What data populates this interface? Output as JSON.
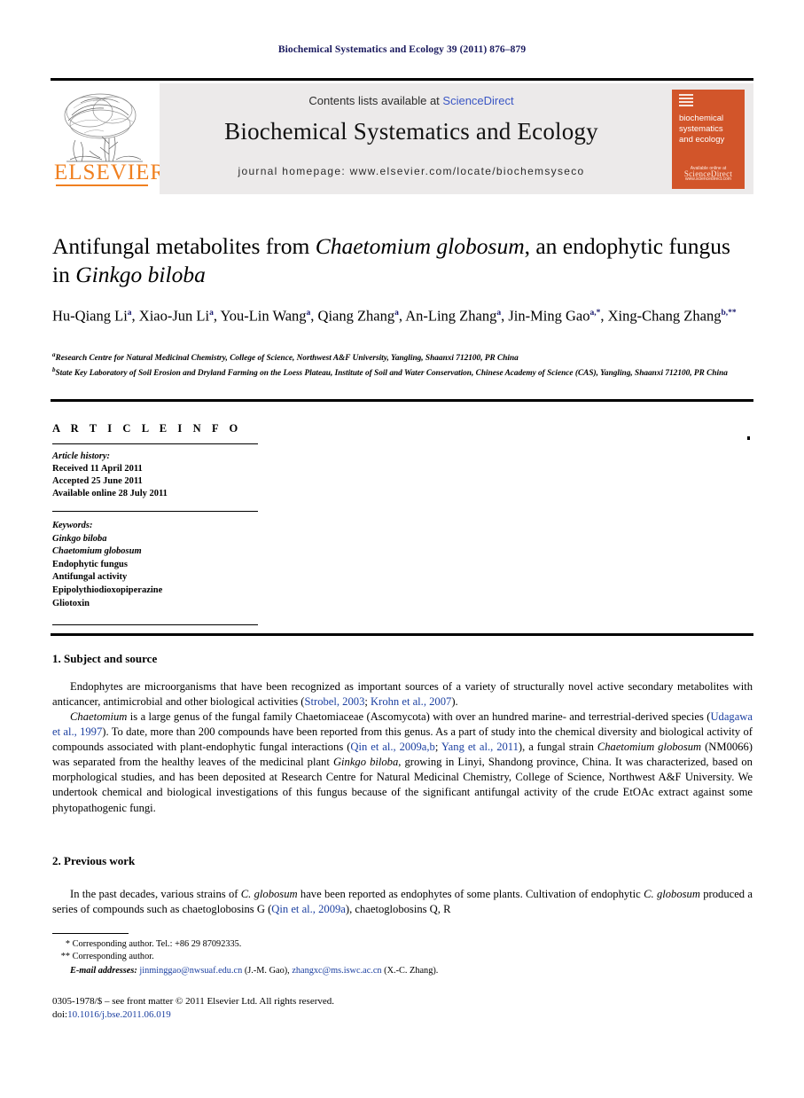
{
  "running_head": "Biochemical Systematics and Ecology 39 (2011) 876–879",
  "masthead": {
    "contents_prefix": "Contents lists available at ",
    "sciencedirect": "ScienceDirect",
    "journal_title": "Biochemical Systematics and Ecology",
    "homepage": "journal homepage: www.elsevier.com/locate/biochemsyseco",
    "publisher_logo_text": "ELSEVIER",
    "cover": {
      "line1": "biochemical",
      "line2": "systematics",
      "line3": "and ecology",
      "foot_small": "Available online at",
      "foot_big": "ScienceDirect",
      "foot_url": "www.sciencedirect.com"
    }
  },
  "article": {
    "title_line1_a": "Antifungal metabolites from ",
    "title_line1_it": "Chaetomium globosum",
    "title_line1_b": ", an endophytic fungus",
    "title_line2_a": "in ",
    "title_line2_it": "Ginkgo biloba",
    "authors": [
      {
        "name": "Hu-Qiang Li",
        "sup": "a",
        "sep": ", "
      },
      {
        "name": "Xiao-Jun Li",
        "sup": "a",
        "sep": ", "
      },
      {
        "name": "You-Lin Wang",
        "sup": "a",
        "sep": ", "
      },
      {
        "name": "Qiang Zhang",
        "sup": "a",
        "sep": ", "
      },
      {
        "name": "An-Ling Zhang",
        "sup": "a",
        "sep": ", "
      },
      {
        "name": "Jin-Ming Gao",
        "sup": "a,*",
        "sep": ", "
      },
      {
        "name": "Xing-Chang Zhang",
        "sup": "b,**",
        "sep": ""
      }
    ],
    "affiliations": [
      {
        "mark": "a",
        "text": "Research Centre for Natural Medicinal Chemistry, College of Science, Northwest A&F University, Yangling, Shaanxi 712100, PR China"
      },
      {
        "mark": "b",
        "text": "State Key Laboratory of Soil Erosion and Dryland Farming on the Loess Plateau, Institute of Soil and Water Conservation, Chinese Academy of Science (CAS), Yangling, Shaanxi 712100, PR China"
      }
    ]
  },
  "article_info": {
    "heading": "A R T I C L E  I N F O",
    "history_label": "Article history:",
    "history": [
      "Received 11 April 2011",
      "Accepted 25 June 2011",
      "Available online 28 July 2011"
    ],
    "keywords_label": "Keywords:",
    "keywords": [
      {
        "text": "Ginkgo biloba",
        "italic": true
      },
      {
        "text": "Chaetomium globosum",
        "italic": true
      },
      {
        "text": "Endophytic fungus",
        "italic": false
      },
      {
        "text": "Antifungal activity",
        "italic": false
      },
      {
        "text": "Epipolythiodioxopiperazine",
        "italic": false
      },
      {
        "text": "Gliotoxin",
        "italic": false
      }
    ]
  },
  "sections": [
    {
      "heading": "1. Subject and source",
      "paragraphs": [
        "Endophytes are microorganisms that have been recognized as important sources of a variety of structurally novel active secondary metabolites with anticancer, antimicrobial and other biological activities (Strobel, 2003; Krohn et al., 2007).",
        "Chaetomium is a large genus of the fungal family Chaetomiaceae (Ascomycota) with over an hundred marine- and terrestrial-derived species (Udagawa et al., 1997). To date, more than 200 compounds have been reported from this genus. As a part of study into the chemical diversity and biological activity of compounds associated with plant-endophytic fungal interactions (Qin et al., 2009a,b; Yang et al., 2011), a fungal strain Chaetomium globosum (NM0066) was separated from the healthy leaves of the medicinal plant Ginkgo biloba, growing in Linyi, Shandong province, China. It was characterized, based on morphological studies, and has been deposited at Research Centre for Natural Medicinal Chemistry, College of Science, Northwest A&F University. We undertook chemical and biological investigations of this fungus because of the significant antifungal activity of the crude EtOAc extract against some phytopathogenic fungi."
      ]
    },
    {
      "heading": "2. Previous work",
      "paragraphs": [
        "In the past decades, various strains of C. globosum have been reported as endophytes of some plants. Cultivation of endophytic C. globosum produced a series of compounds such as chaetoglobosins G (Qin et al., 2009a), chaetoglobosins Q, R"
      ]
    }
  ],
  "footnotes": [
    {
      "mark": "*",
      "text": "Corresponding author. Tel.: +86 29 87092335."
    },
    {
      "mark": "**",
      "text": "Corresponding author."
    }
  ],
  "email_footnote": {
    "label": "E-mail addresses:",
    "email1": "jinminggao@nwsuaf.edu.cn",
    "who1": "(J.-M. Gao)",
    "email2": "zhangxc@ms.iswc.ac.cn",
    "who2": "(X.-C. Zhang)."
  },
  "copyright": {
    "line1": "0305-1978/$ – see front matter © 2011 Elsevier Ltd. All rights reserved.",
    "doi_label": "doi:",
    "doi": "10.1016/j.bse.2011.06.019"
  },
  "colors": {
    "running_head": "#1a1a5e",
    "link": "#1b3fa0",
    "sciencedirect": "#3a56c4",
    "elsevier_orange": "#f08020",
    "cover_orange": "#d2552a",
    "masthead_bg": "#eceaea"
  }
}
